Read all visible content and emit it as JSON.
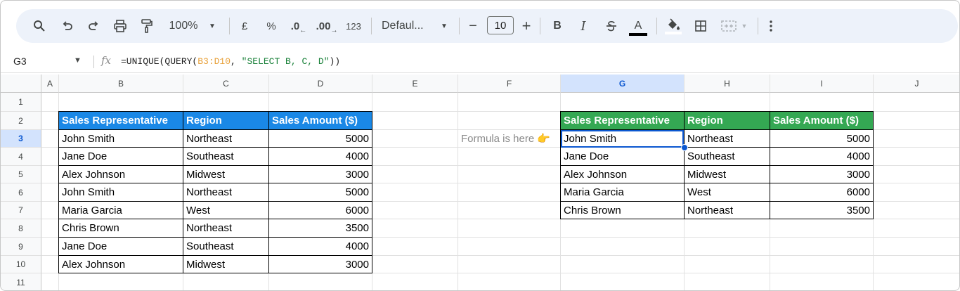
{
  "toolbar": {
    "zoom": "100%",
    "currency": "£",
    "percent": "%",
    "decrease_decimal": ".0",
    "increase_decimal": ".00",
    "number_format": "123",
    "font": "Defaul...",
    "font_size": "10",
    "minus": "−",
    "plus": "+",
    "bold": "B",
    "italic": "I",
    "text_color_label": "A",
    "accent_color": "#0b57d0"
  },
  "formula_bar": {
    "name_box": "G3",
    "fx": "fx",
    "formula_prefix": "=UNIQUE(QUERY(",
    "formula_range": "B3:D10",
    "formula_mid": ", ",
    "formula_string": "\"SELECT B, C, D\"",
    "formula_suffix": "))"
  },
  "columns": [
    "A",
    "B",
    "C",
    "D",
    "E",
    "F",
    "G",
    "H",
    "I",
    "J"
  ],
  "rows": [
    "1",
    "2",
    "3",
    "4",
    "5",
    "6",
    "7",
    "8",
    "9",
    "10",
    "11"
  ],
  "source_table": {
    "headers": [
      "Sales Representative",
      "Region",
      "Sales Amount ($)"
    ],
    "rows": [
      [
        "John Smith",
        "Northeast",
        "5000"
      ],
      [
        "Jane Doe",
        "Southeast",
        "4000"
      ],
      [
        "Alex Johnson",
        "Midwest",
        "3000"
      ],
      [
        "John Smith",
        "Northeast",
        "5000"
      ],
      [
        "Maria Garcia",
        "West",
        "6000"
      ],
      [
        "Chris Brown",
        "Northeast",
        "3500"
      ],
      [
        "Jane Doe",
        "Southeast",
        "4000"
      ],
      [
        "Alex Johnson",
        "Midwest",
        "3000"
      ]
    ],
    "header_color": "#1a88e6"
  },
  "result_table": {
    "headers": [
      "Sales Representative",
      "Region",
      "Sales Amount ($)"
    ],
    "rows": [
      [
        "John Smith",
        "Northeast",
        "5000"
      ],
      [
        "Jane Doe",
        "Southeast",
        "4000"
      ],
      [
        "Alex Johnson",
        "Midwest",
        "3000"
      ],
      [
        "Maria Garcia",
        "West",
        "6000"
      ],
      [
        "Chris Brown",
        "Northeast",
        "3500"
      ]
    ],
    "header_color": "#34a853"
  },
  "note": "Formula is here 👉"
}
